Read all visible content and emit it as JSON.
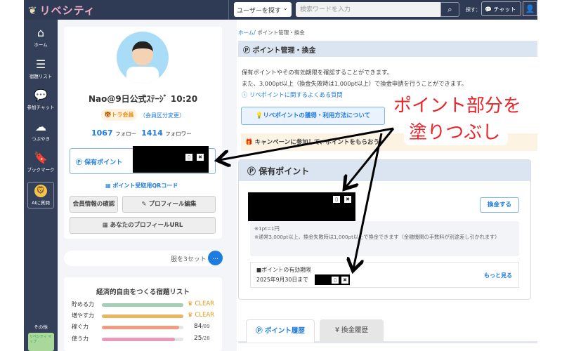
{
  "header": {
    "logo": "リベシティ",
    "user_search_select": "ユーザーを探す",
    "search_placeholder": "検索ワードを入力",
    "find_label": "探す：",
    "chat_button": "チャット"
  },
  "sidebar": {
    "items": [
      {
        "label": "ホーム",
        "icon": "home-icon"
      },
      {
        "label": "宿題リスト",
        "icon": "checklist-icon"
      },
      {
        "label": "参加チャット",
        "icon": "chat-icon"
      },
      {
        "label": "つぶやき",
        "icon": "tweet-icon"
      },
      {
        "label": "ブックマーク",
        "icon": "bookmark-icon"
      },
      {
        "label": "AIに質問",
        "icon": "ai-lion-icon"
      }
    ],
    "other_label": "その他",
    "other_banner": "リベシティ マップ"
  },
  "profile": {
    "name": "Nao@9日公式ｽﾃｰｼﾞ 10:20",
    "badge": "トラ会員",
    "member_change": "（会員区分変更）",
    "follow_count": "1067",
    "follow_label": "フォロー",
    "follower_count": "1414",
    "follower_label": "フォロワー",
    "points_label": "保有ポイント",
    "qr_link": "ポイント受取用QRコード",
    "member_info_button": "会員情報の確認",
    "edit_profile_button": "プロフィール編集",
    "profile_url_button": "あなたのプロフィールURL"
  },
  "tweet_pill": "服を3セット",
  "homework": {
    "title": "経済的自由をつくる宿題リスト",
    "rows": [
      {
        "label": "貯める力",
        "progress": 1.0,
        "color": "#9fd0b3",
        "value": "CLEAR"
      },
      {
        "label": "増やす力",
        "progress": 1.0,
        "color": "#e9b65e",
        "value": "CLEAR"
      },
      {
        "label": "稼ぐ力",
        "progress": 0.944,
        "color": "#ef9e85",
        "value": "84",
        "total": "/89"
      },
      {
        "label": "使う力",
        "progress": 0.893,
        "color": "#e99ab9",
        "value": "25",
        "total": "/28"
      }
    ]
  },
  "main": {
    "breadcrumb_home": "ホーム/",
    "breadcrumb_current": "ポイント管理・換金",
    "title": "ポイント管理・換金",
    "desc1": "保有ポイントやその有効期限を確認することができます。",
    "desc2": "また、3,000pt以上（換金失敗時は1,000pt以上）で換金申請を行うことができます。",
    "faq_link": "リベポイントに関するよくある質問",
    "howto_button": "リベポイントの獲得・利用方法について",
    "campaign": "キャンペーンに参加して、ポイントをもらおう！",
    "holding_title": "保有ポイント",
    "exchange_button": "換金する",
    "note1": "※1pt=1円",
    "note2": "※通常3,000pt以上、換金失敗時は1,000pt以上で換金できます（金融機関の手数料が別途差し引かれます）",
    "expiry_label": "■ポイントの有効期限",
    "expiry_date": "2025年9月30日まで",
    "more_link": "もっと見る",
    "tabs": [
      "ポイント履歴",
      "¥ 換金履歴"
    ]
  },
  "annotation": {
    "line1": "ポイント部分を",
    "line2": "塗りつぶし"
  },
  "colors": {
    "header": "#2f3b55",
    "accent": "#1e7be0",
    "annotation": "#e8252b",
    "clear": "#e89a1a"
  }
}
